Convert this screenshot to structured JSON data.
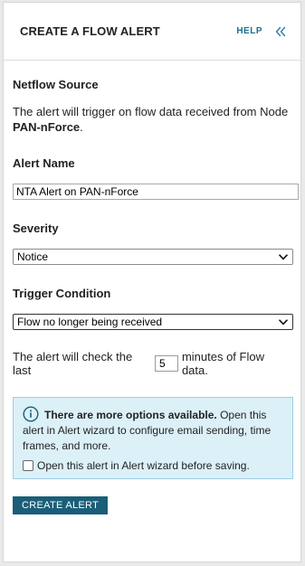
{
  "header": {
    "title": "CREATE A FLOW ALERT",
    "help_label": "HELP"
  },
  "netflow": {
    "heading": "Netflow Source",
    "description_prefix": "The alert will trigger on flow data received from Node ",
    "node_name": "PAN-nForce",
    "description_suffix": "."
  },
  "alert_name": {
    "heading": "Alert Name",
    "value": "NTA Alert on PAN-nForce"
  },
  "severity": {
    "heading": "Severity",
    "selected": "Notice"
  },
  "trigger": {
    "heading": "Trigger Condition",
    "selected": "Flow no longer being received"
  },
  "check": {
    "prefix": "The alert will check the last",
    "minutes": "5",
    "suffix": "minutes of Flow data."
  },
  "info": {
    "bold": "There are more options available.",
    "text": " Open this alert in Alert wizard to configure email sending, time frames, and more.",
    "checkbox_label": "Open this alert in Alert wizard before saving.",
    "checkbox_checked": false
  },
  "actions": {
    "create_label": "CREATE ALERT"
  },
  "colors": {
    "accent": "#1a5e78",
    "link": "#1a6f90",
    "info_bg": "#dcf0f8",
    "info_border": "#9ccfe3"
  },
  "icons": {
    "collapse": "double-chevron-left-icon",
    "info": "info-circle-icon",
    "dropdown": "chevron-down-icon"
  }
}
